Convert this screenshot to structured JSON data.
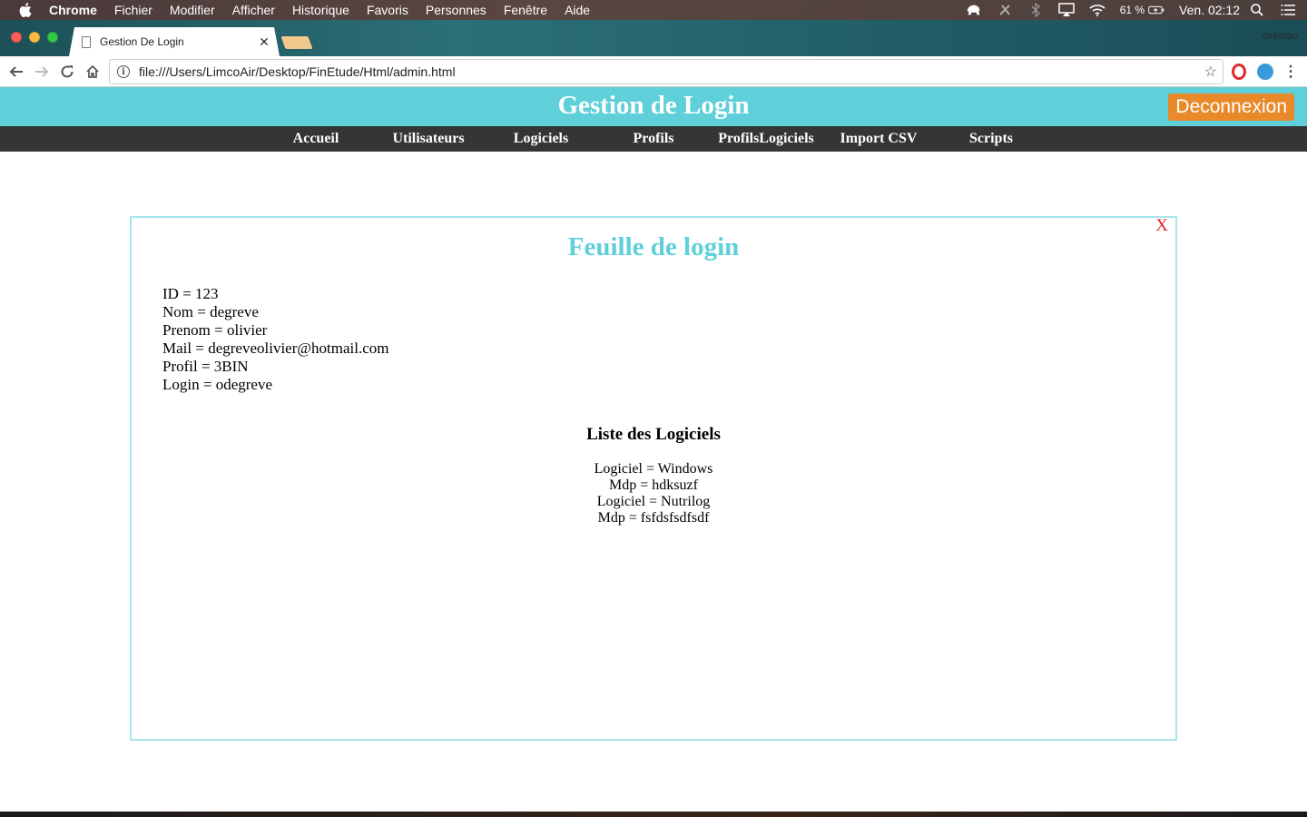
{
  "menubar": {
    "app": "Chrome",
    "items": [
      "Fichier",
      "Modifier",
      "Afficher",
      "Historique",
      "Favoris",
      "Personnes",
      "Fenêtre",
      "Aide"
    ],
    "battery": "61 %",
    "clock": "Ven. 02:12"
  },
  "browser": {
    "tab_title": "Gestion De Login",
    "profile": "dekotao",
    "url": "file:///Users/LimcoAir/Desktop/FinEtude/Html/admin.html"
  },
  "header": {
    "title": "Gestion de Login",
    "logout_label": "Deconnexion"
  },
  "nav": [
    "Accueil",
    "Utilisateurs",
    "Logiciels",
    "Profils",
    "ProfilsLogiciels",
    "Import CSV",
    "Scripts"
  ],
  "modal": {
    "close_label": "X",
    "title": "Feuille de login",
    "details": [
      "ID = 123",
      "Nom = degreve",
      "Prenom = olivier",
      "Mail = degreveolivier@hotmail.com",
      "Profil = 3BIN",
      "Login = odegreve"
    ],
    "software_title": "Liste des Logiciels",
    "software": [
      "Logiciel = Windows",
      "Mdp = hdksuzf",
      "Logiciel = Nutrilog",
      "Mdp = fsfdsfsdfsdf"
    ]
  },
  "colors": {
    "header_bg": "#5fcfd9",
    "nav_bg": "#353535",
    "logout_bg": "#e8892a",
    "modal_title": "#5fcfd9",
    "modal_close": "#e02020"
  }
}
